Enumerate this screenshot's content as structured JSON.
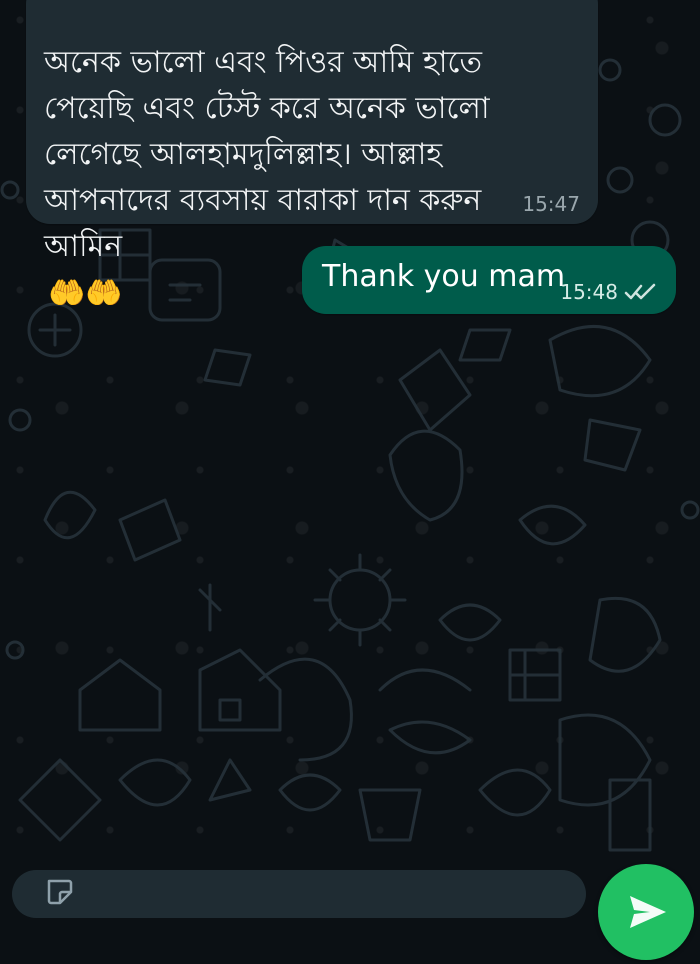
{
  "chat": {
    "messages": [
      {
        "direction": "incoming",
        "text": "অনেক ভালো এবং পিওর আমি হাতে\nপেয়েছি এবং টেস্ট করে অনেক ভালো\nলেগেছে আলহামদুলিল্লাহ। আল্লাহ\nআপনাদের ব্যবসায় বারাকা দান করুন\nআমিন",
        "emoji": "🤲🤲",
        "time": "15:47"
      },
      {
        "direction": "outgoing",
        "text": "Thank you mam",
        "time": "15:48",
        "status_icon": "double-check-icon"
      }
    ]
  },
  "theme": {
    "background": "#0b1014",
    "incoming_bubble": "#1f2c33",
    "outgoing_bubble": "#005c4b",
    "send_button": "#21c063",
    "time_color": "#9aa7ad"
  },
  "composer": {
    "icons": [
      "sticker-icon",
      "send-icon"
    ]
  }
}
